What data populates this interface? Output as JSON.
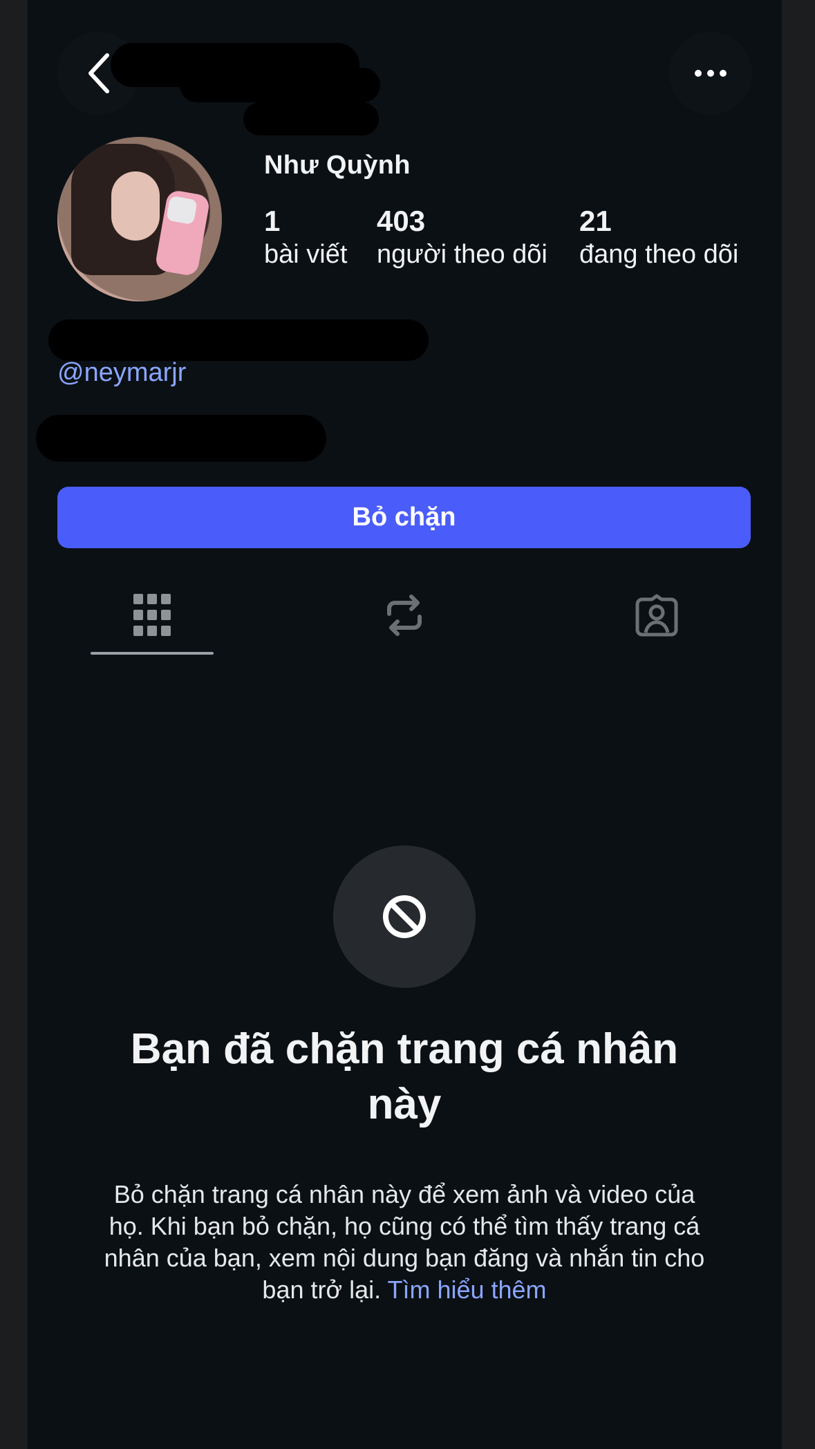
{
  "header": {
    "back_icon": "chevron-left-icon",
    "more_icon": "more-horizontal-icon"
  },
  "profile": {
    "display_name": "Như Quỳnh",
    "stats": [
      {
        "value": "1",
        "label": "bài viết"
      },
      {
        "value": "403",
        "label": "người theo dõi"
      },
      {
        "value": "21",
        "label": "đang theo dõi"
      }
    ],
    "mention": "@neymarjr"
  },
  "actions": {
    "unblock_label": "Bỏ chặn"
  },
  "tabs": [
    {
      "icon": "grid-icon",
      "active": true
    },
    {
      "icon": "repost-icon",
      "active": false
    },
    {
      "icon": "tagged-person-icon",
      "active": false
    }
  ],
  "blocked_state": {
    "icon": "block-icon",
    "title": "Bạn đã chặn trang cá nhân này",
    "description": "Bỏ chặn trang cá nhân này để xem ảnh và video của họ. Khi bạn bỏ chặn, họ cũng có thể tìm thấy trang cá nhân của bạn, xem nội dung bạn đăng và nhắn tin cho bạn trở lại.",
    "learn_more_label": "Tìm hiểu thêm"
  },
  "colors": {
    "background": "#0b1014",
    "accent_button": "#4a5dfa",
    "link": "#8aa6ff"
  }
}
